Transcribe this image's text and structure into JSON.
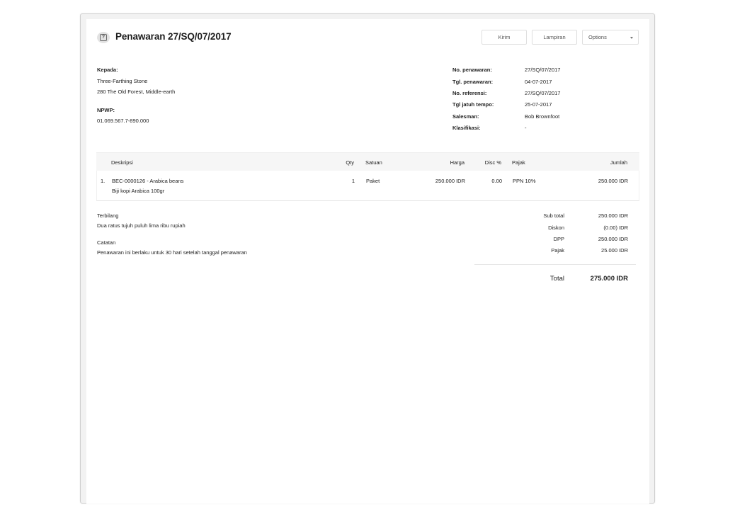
{
  "header": {
    "title": "Penawaran 27/SQ/07/2017",
    "buttons": {
      "kirim": "Kirim",
      "lampiran": "Lampiran",
      "options": "Options"
    }
  },
  "recipient": {
    "label": "Kepada:",
    "name": "Three-Farthing Stone",
    "address": "280 The Old Forest, Middle-earth",
    "npwp_label": "NPWP:",
    "npwp": "01.069.567.7-890.000"
  },
  "info": [
    {
      "label": "No. penawaran:",
      "value": "27/SQ/07/2017"
    },
    {
      "label": "Tgl. penawaran:",
      "value": "04-07-2017"
    },
    {
      "label": "No. referensi:",
      "value": "27/SQ/07/2017"
    },
    {
      "label": "Tgl jatuh tempo:",
      "value": "25-07-2017"
    },
    {
      "label": "Salesman:",
      "value": "Bob Brownfoot"
    },
    {
      "label": "Klasifikasi:",
      "value": "-"
    }
  ],
  "table": {
    "headers": {
      "deskripsi": "Deskripsi",
      "qty": "Qty",
      "satuan": "Satuan",
      "harga": "Harga",
      "disc": "Disc %",
      "pajak": "Pajak",
      "jumlah": "Jumlah"
    },
    "rows": [
      {
        "no": "1.",
        "item": "BEC-0000126 - Arabica beans",
        "description": "Biji kopi Arabica 100gr",
        "qty": "1",
        "satuan": "Paket",
        "harga": "250.000 IDR",
        "disc": "0.00",
        "pajak": "PPN 10%",
        "jumlah": "250.000 IDR"
      }
    ]
  },
  "notes": {
    "terbilang_label": "Terbilang",
    "terbilang": "Dua ratus tujuh puluh lima ribu rupiah",
    "catatan_label": "Catatan",
    "catatan": "Penawaran ini berlaku untuk 30 hari setelah tanggal penawaran"
  },
  "summary": [
    {
      "label": "Sub total",
      "value": "250.000 IDR"
    },
    {
      "label": "Diskon",
      "value": "(0.00) IDR"
    },
    {
      "label": "DPP",
      "value": "250.000 IDR"
    },
    {
      "label": "Pajak",
      "value": "25.000 IDR"
    }
  ],
  "total": {
    "label": "Total",
    "value": "275.000 IDR"
  }
}
